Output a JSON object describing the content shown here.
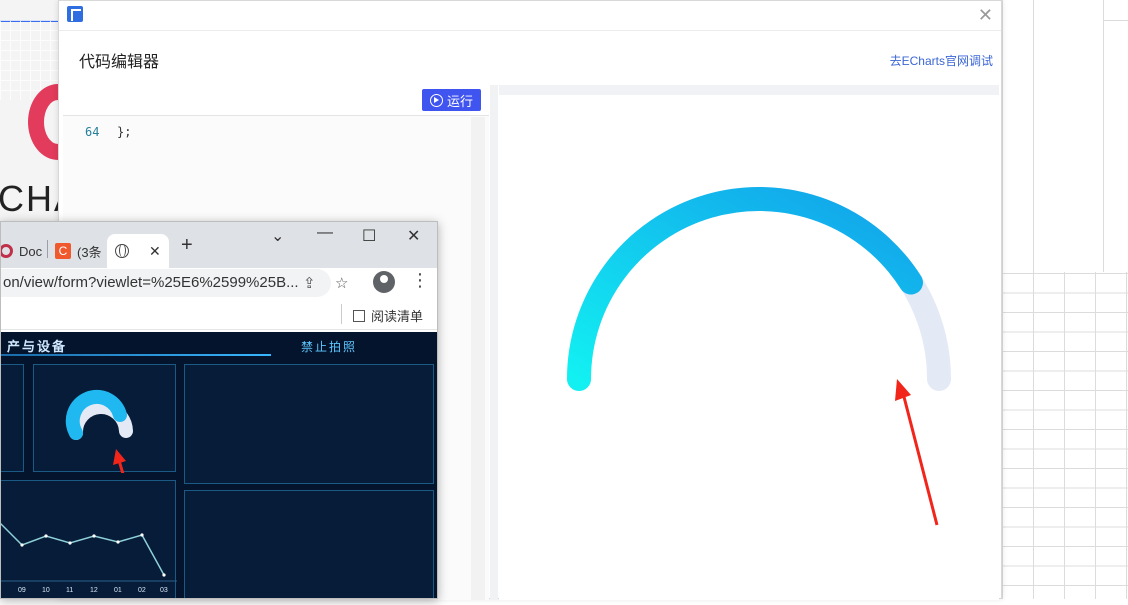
{
  "background": {
    "left_logo_text": "CHA",
    "accent_color": "#e23b5b"
  },
  "editor_dialog": {
    "title": "代码编辑器",
    "echarts_link": "去ECharts官网调试",
    "close_icon": "close-icon",
    "run_button": "运行",
    "code": [
      {
        "line": "64",
        "text": "};"
      }
    ]
  },
  "gauge": {
    "value_fraction": 0.82,
    "colors": {
      "start": "#12f0f2",
      "end": "#12a0ea",
      "track": "#e4eaf5"
    }
  },
  "browser": {
    "tabs": [
      {
        "label": "Doc",
        "icon": "doc-favicon"
      },
      {
        "label": "(3条",
        "icon": "c-favicon"
      },
      {
        "label": "",
        "icon": "globe-icon"
      }
    ],
    "url": "on/view/form?viewlet=%25E6%2599%25B...",
    "bookmarks_reading_list": "阅读清单",
    "dashboard": {
      "title": "产与设备",
      "warning": "禁止拍照",
      "x_ticks": [
        "09",
        "10",
        "11",
        "12",
        "01",
        "02",
        "03"
      ]
    }
  },
  "annotations": {
    "arrow_color": "#f2251a"
  }
}
